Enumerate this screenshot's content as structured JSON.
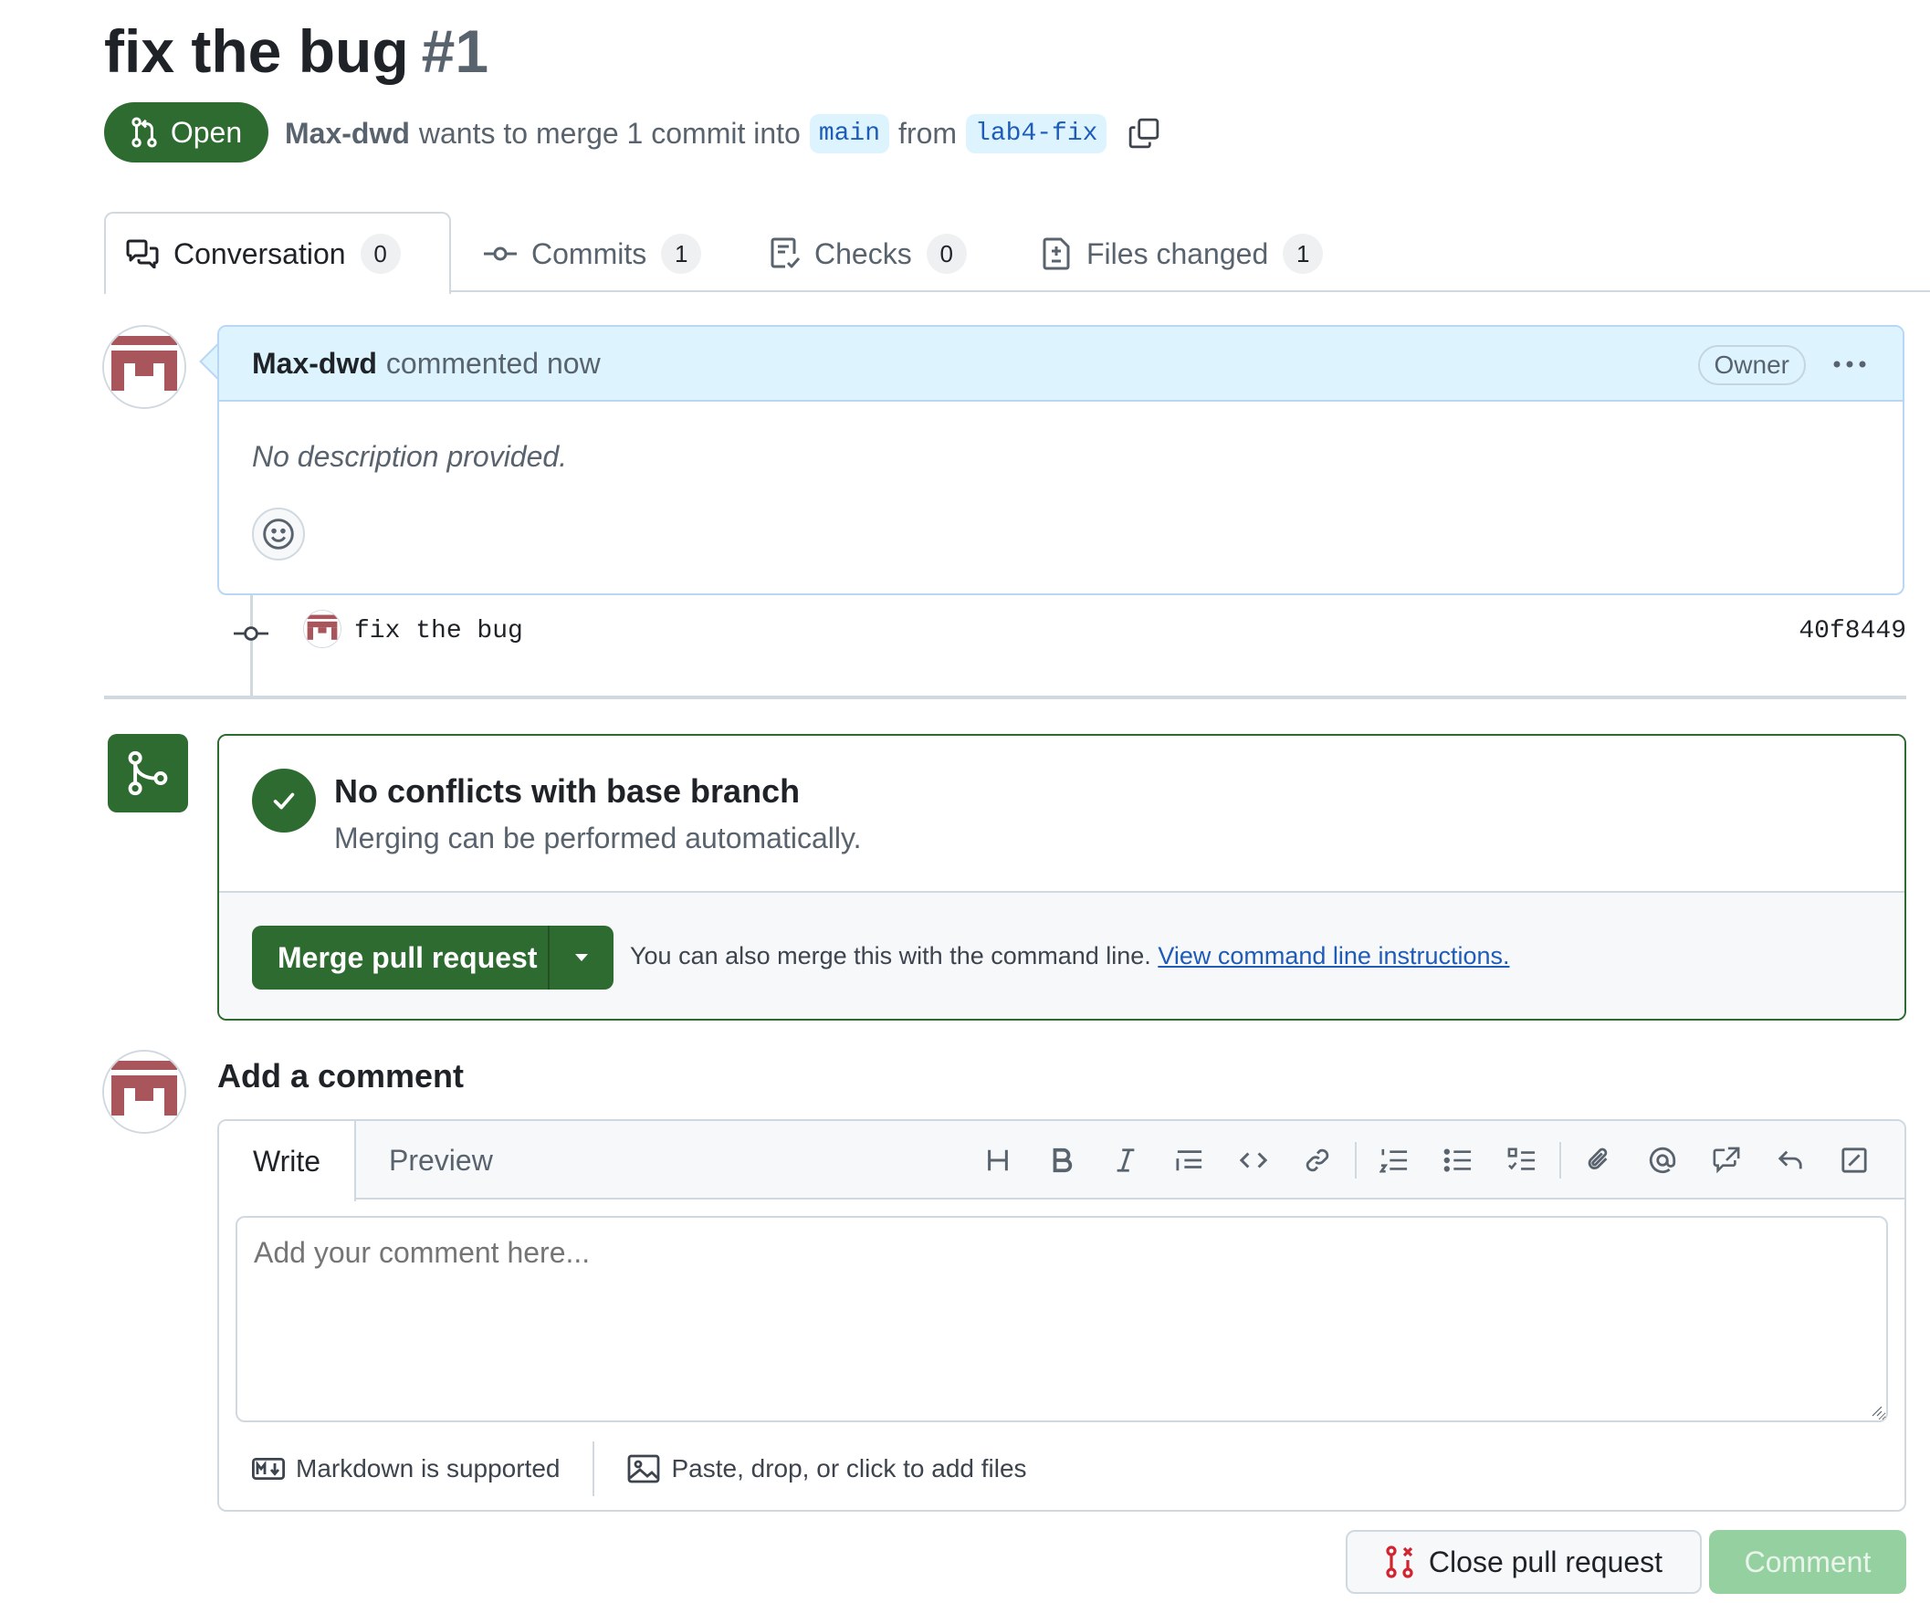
{
  "pr": {
    "title": "fix the bug",
    "number": "#1",
    "state": "Open",
    "author": "Max-dwd",
    "merge_text": "wants to merge 1 commit into",
    "base_branch": "main",
    "from_text": "from",
    "head_branch": "lab4-fix"
  },
  "tabs": [
    {
      "label": "Conversation",
      "count": "0",
      "icon": "comment-discussion-icon"
    },
    {
      "label": "Commits",
      "count": "1",
      "icon": "git-commit-icon"
    },
    {
      "label": "Checks",
      "count": "0",
      "icon": "checklist-icon"
    },
    {
      "label": "Files changed",
      "count": "1",
      "icon": "file-diff-icon"
    }
  ],
  "comment": {
    "author": "Max-dwd",
    "action": "commented now",
    "role_badge": "Owner",
    "body": "No description provided."
  },
  "commit": {
    "message": "fix the bug",
    "sha": "40f8449"
  },
  "merge": {
    "title": "No conflicts with base branch",
    "subtitle": "Merging can be performed automatically.",
    "button_label": "Merge pull request",
    "hint": "You can also merge this with the command line.",
    "hint_link": "View command line instructions."
  },
  "add_comment": {
    "title": "Add a comment",
    "tab_write": "Write",
    "tab_preview": "Preview",
    "placeholder": "Add your comment here...",
    "markdown_note": "Markdown is supported",
    "attach_note": "Paste, drop, or click to add files"
  },
  "actions": {
    "close_label": "Close pull request",
    "comment_label": "Comment"
  },
  "colors": {
    "open_green": "#2e6b30",
    "link_blue": "#1f5cb8",
    "comment_header_bg": "#ddf4ff",
    "comment_button_disabled": "#95d1a0",
    "close_icon_red": "#d1242f"
  }
}
